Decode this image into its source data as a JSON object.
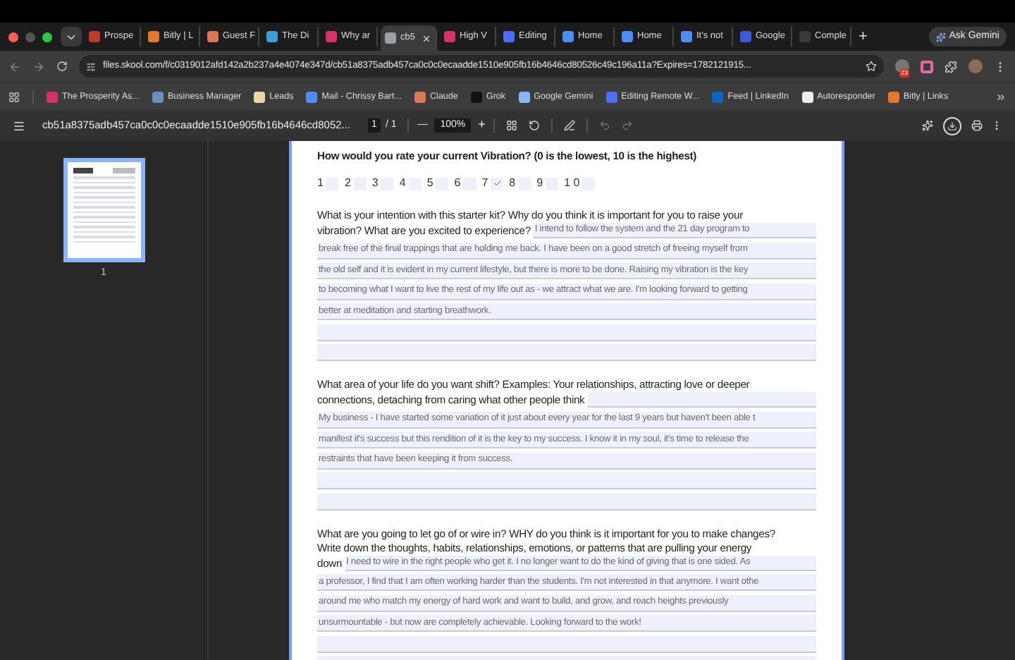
{
  "browser": {
    "tabs": [
      {
        "title": "Prospe",
        "color": "#c0392b",
        "selected": false
      },
      {
        "title": "Bitly | L",
        "color": "#e8762c",
        "selected": false
      },
      {
        "title": "Guest F",
        "color": "#d97757",
        "selected": false
      },
      {
        "title": "The Di",
        "color": "#3aa0d8",
        "selected": false
      },
      {
        "title": "Why ar",
        "color": "#d6336c",
        "selected": false
      },
      {
        "title": "cb5",
        "color": "#9aa0a6",
        "selected": true
      },
      {
        "title": "High V",
        "color": "#d6336c",
        "selected": false
      },
      {
        "title": "Editing",
        "color": "#4c6ef5",
        "selected": false
      },
      {
        "title": "Home",
        "color": "#4c8ef5",
        "selected": false
      },
      {
        "title": "Home",
        "color": "#4c8ef5",
        "selected": false
      },
      {
        "title": "It's not",
        "color": "#4c8ef5",
        "selected": false
      },
      {
        "title": "Google",
        "color": "#3b5bdb",
        "selected": false
      },
      {
        "title": "Comple",
        "color": "#3a3a3a",
        "selected": false
      }
    ],
    "new_tab": "+",
    "ask_button": "Ask Gemini",
    "url": "files.skool.com/f/c0319012afd142a2b237a4e4074e347d/cb51a8375adb457ca0c0c0ecaadde1510e905fb16b4646cd80526c49c196a11a?Expires=1782121915...",
    "extension_badge": "23",
    "bookmarks": [
      {
        "title": "The Prosperity As...",
        "color": "#d6336c"
      },
      {
        "title": "Business Manager",
        "color": "#6c8ebf"
      },
      {
        "title": "Leads",
        "color": "#e9d8a6"
      },
      {
        "title": "Mail - Chrissy Bart...",
        "color": "#4c8ef5"
      },
      {
        "title": "Claude",
        "color": "#d97757"
      },
      {
        "title": "Grok",
        "color": "#111111"
      },
      {
        "title": "Google Gemini",
        "color": "#8ab4f8"
      },
      {
        "title": "Editing Remote W...",
        "color": "#4c6ef5"
      },
      {
        "title": "Feed | LinkedIn",
        "color": "#0a66c2"
      },
      {
        "title": "Autoresponder",
        "color": "#eeeeee"
      },
      {
        "title": "Bitly | Links",
        "color": "#e8762c"
      }
    ]
  },
  "pdf": {
    "filename": "cb51a8375adb457ca0c0c0ecaadde1510e905fb16b4646cd8052...",
    "page": "1",
    "page_total": "/ 1",
    "zoom": "100%",
    "zoom_out": "—",
    "zoom_in": "+",
    "thumbnail_label": "1"
  },
  "form": {
    "rating_question": "How would you rate your current Vibration? (0 is the lowest, 10 is the highest)",
    "rating_options": [
      {
        "label": "1",
        "checked": false
      },
      {
        "label": "2",
        "checked": false
      },
      {
        "label": "3",
        "checked": false
      },
      {
        "label": "4",
        "checked": false
      },
      {
        "label": "5",
        "checked": false
      },
      {
        "label": "6",
        "checked": false
      },
      {
        "label": "7",
        "checked": true
      },
      {
        "label": "8",
        "checked": false
      },
      {
        "label": "9",
        "checked": false
      },
      {
        "label": "1 0",
        "checked": false
      }
    ],
    "questions": [
      {
        "prompt_lines": [
          "What is your intention with this starter kit? Why do you think it is important for you to raise your",
          "vibration? What are you excited to experience?"
        ],
        "inline_answer": "I intend to follow the system and the 21 day program to",
        "answer_lines": [
          "break free of the final trappings that are holding me back. I have been on a good stretch of freeing myself from",
          "the old self and it is evident in my current lifestyle, but there is more to be done. Raising my vibration is the key",
          "to becoming what I want to live the rest of my life out as - we attract what we are. I'm looking forward to getting",
          "better at meditation and starting breathwork."
        ]
      },
      {
        "prompt_lines": [
          "What area of your life do you want shift?  Examples: Your relationships, attracting love or deeper",
          "connections, detaching from caring what other people think"
        ],
        "answer_lines": [
          "My business - I have started some variation of it just about every year for the last 9 years but haven't been able t",
          "manifest it's success but this rendition of it is the key to my success. I know it in my soul, it's time to release the",
          "restraints that have been keeping it from success."
        ]
      },
      {
        "prompt_lines": [
          "What are you going to let go of or wire in? WHY do you think is it important for you to make changes?",
          "Write down the thoughts, habits, relationships, emotions, or patterns that are pulling your energy",
          "down"
        ],
        "inline_answer": "I need to wire in the right people who get it. I no longer want to do the kind of giving that is one sided. As",
        "answer_lines": [
          "a professor, I find that I am often working harder than the students. I'm not interested in that anymore. I want othe",
          "around me who match my energy of hard work and want to build, and grow, and reach heights previously",
          "unsurmountable - but now are completely achievable. Looking forward to the work!"
        ]
      }
    ]
  }
}
